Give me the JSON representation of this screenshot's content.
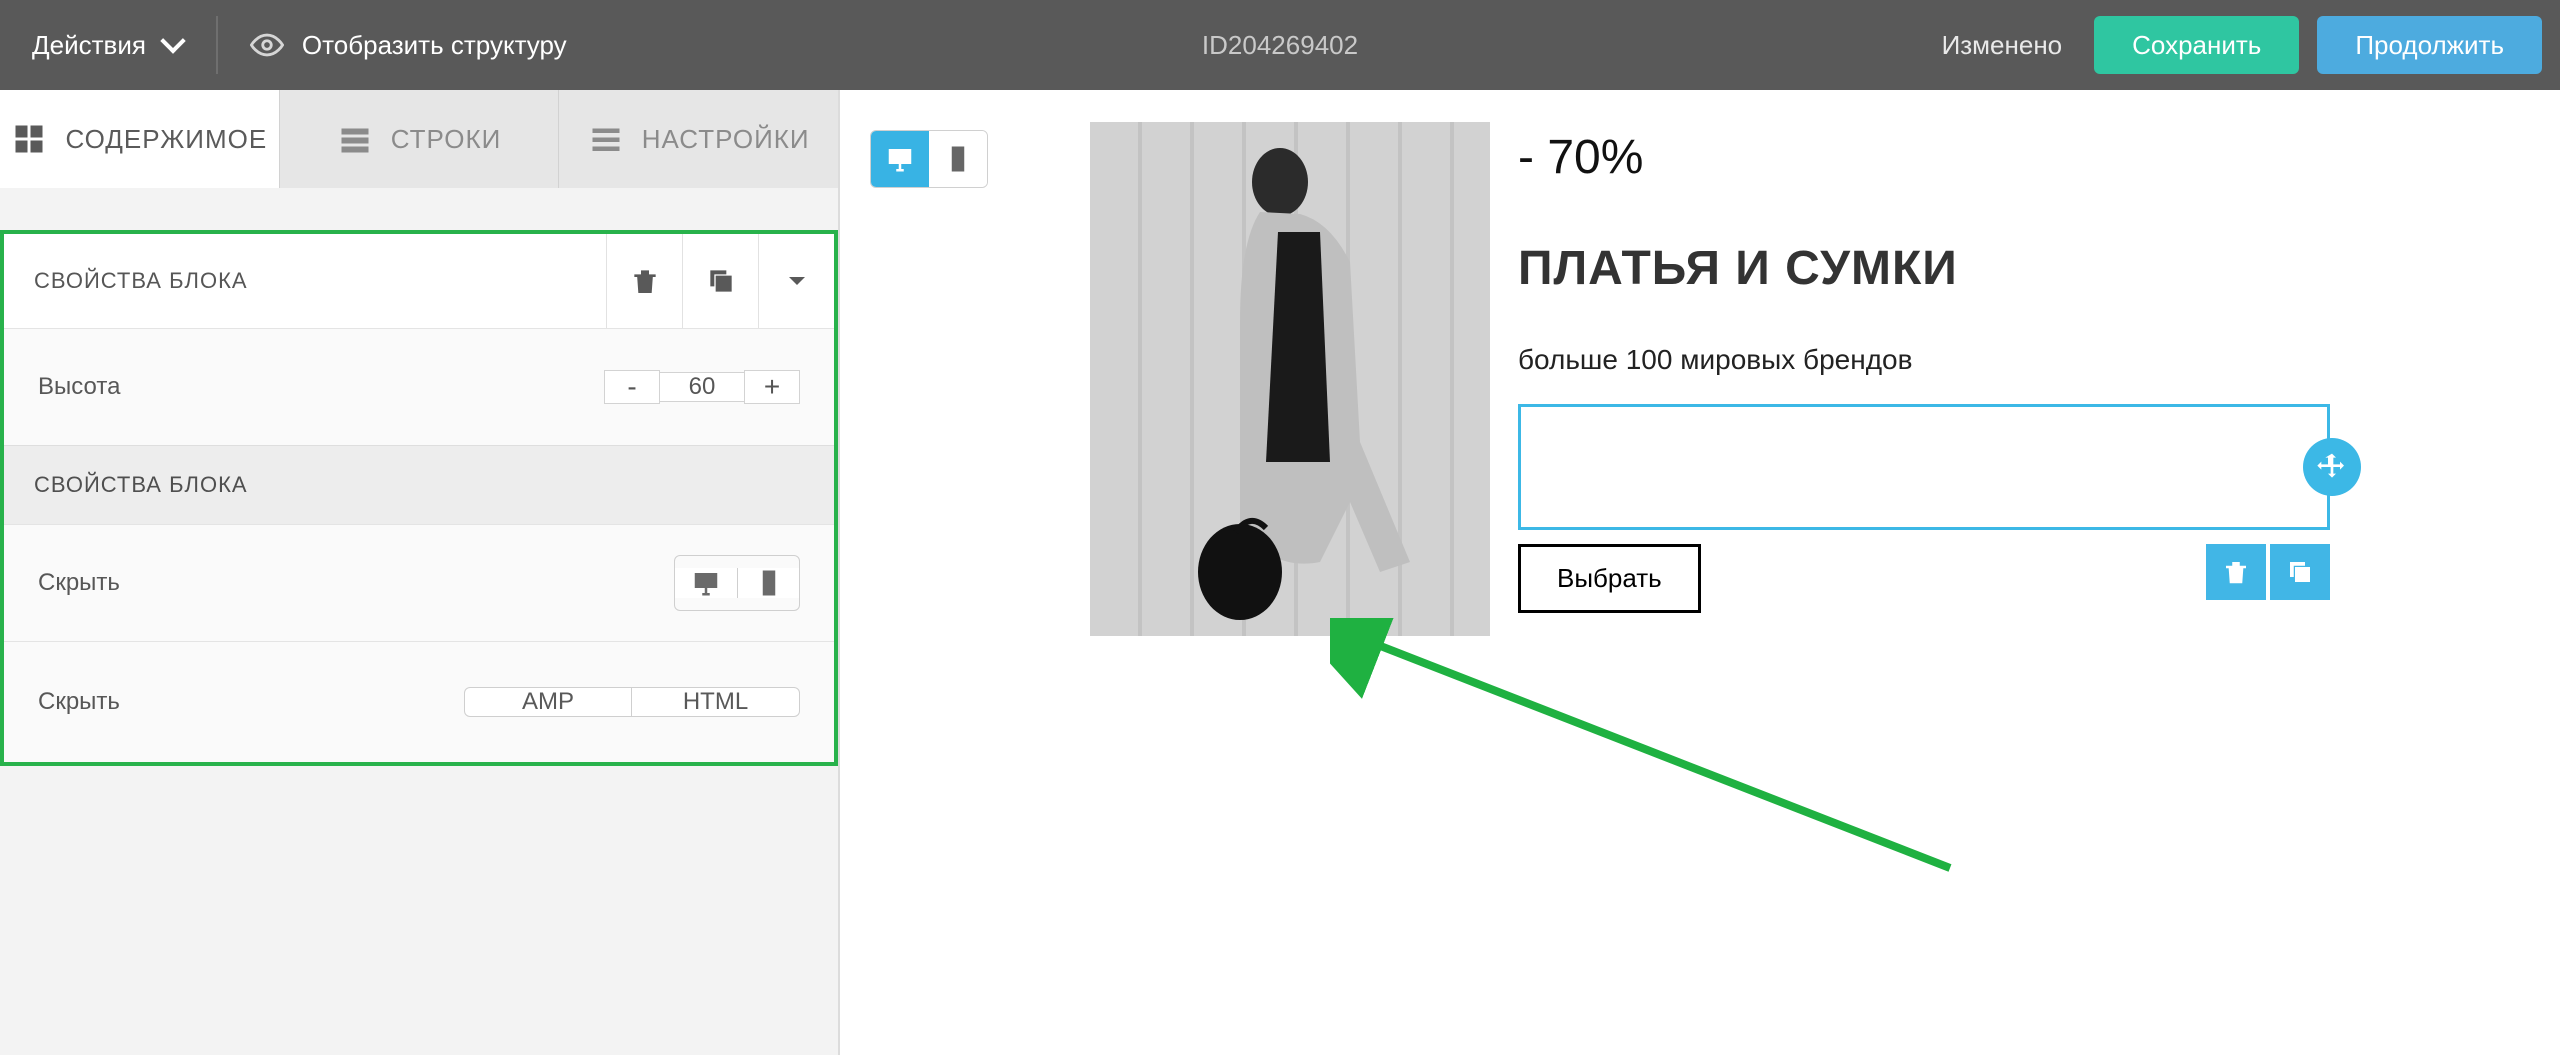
{
  "topbar": {
    "actions": "Действия",
    "show_structure": "Отобразить структуру",
    "id": "ID204269402",
    "status": "Изменено",
    "save": "Сохранить",
    "continue": "Продолжить"
  },
  "tabs": {
    "content": "СОДЕРЖИМОЕ",
    "rows": "СТРОКИ",
    "settings": "НАСТРОЙКИ"
  },
  "panel": {
    "block_properties": "СВОЙСТВА БЛОКА",
    "height_label": "Высота",
    "height_value": "60",
    "block_properties_2": "СВОЙСТВА БЛОКА",
    "hide_1": "Скрыть",
    "hide_2": "Скрыть",
    "format_amp": "AMP",
    "format_html": "HTML"
  },
  "canvas": {
    "discount": "- 70%",
    "title": "ПЛАТЬЯ И СУМКИ",
    "subtitle": "больше 100 мировых брендов",
    "select_button": "Выбрать"
  }
}
